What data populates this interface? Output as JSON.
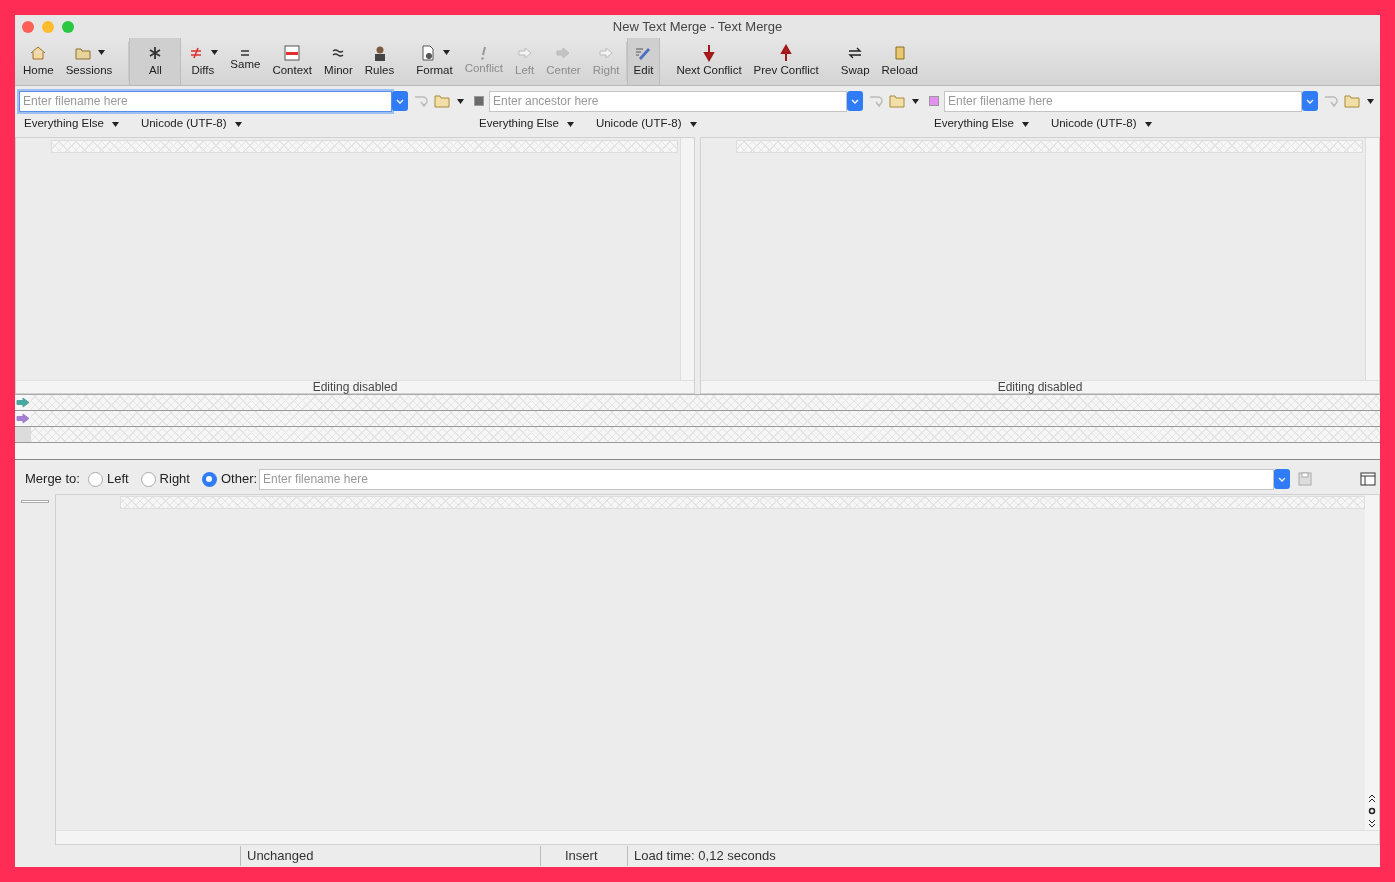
{
  "window": {
    "title": "New Text Merge - Text Merge"
  },
  "toolbar": [
    {
      "label": "Home",
      "selected": false,
      "disabled": false,
      "dropdown": false
    },
    {
      "label": "Sessions",
      "selected": false,
      "disabled": false,
      "dropdown": true
    },
    {
      "label": "All",
      "selected": true,
      "disabled": false,
      "dropdown": false
    },
    {
      "label": "Diffs",
      "selected": false,
      "disabled": false,
      "dropdown": true
    },
    {
      "label": "Same",
      "selected": false,
      "disabled": false,
      "dropdown": false
    },
    {
      "label": "Context",
      "selected": false,
      "disabled": false,
      "dropdown": false
    },
    {
      "label": "Minor",
      "selected": false,
      "disabled": false,
      "dropdown": false
    },
    {
      "label": "Rules",
      "selected": false,
      "disabled": false,
      "dropdown": false
    },
    {
      "label": "Format",
      "selected": false,
      "disabled": false,
      "dropdown": true
    },
    {
      "label": "Conflict",
      "selected": false,
      "disabled": true,
      "dropdown": false
    },
    {
      "label": "Left",
      "selected": false,
      "disabled": true,
      "dropdown": false
    },
    {
      "label": "Center",
      "selected": false,
      "disabled": true,
      "dropdown": false
    },
    {
      "label": "Right",
      "selected": false,
      "disabled": true,
      "dropdown": false
    },
    {
      "label": "Edit",
      "selected": true,
      "disabled": false,
      "dropdown": false
    },
    {
      "label": "Next Conflict",
      "selected": false,
      "disabled": false,
      "dropdown": false
    },
    {
      "label": "Prev Conflict",
      "selected": false,
      "disabled": false,
      "dropdown": false
    },
    {
      "label": "Swap",
      "selected": false,
      "disabled": false,
      "dropdown": false
    },
    {
      "label": "Reload",
      "selected": false,
      "disabled": false,
      "dropdown": false
    }
  ],
  "files": [
    {
      "placeholder": "Enter filename here",
      "focused": true,
      "filter": "Everything Else",
      "encoding": "Unicode (UTF-8)"
    },
    {
      "placeholder": "Enter ancestor here",
      "focused": false,
      "color": "#6b6b6b",
      "filter": "Everything Else",
      "encoding": "Unicode (UTF-8)"
    },
    {
      "placeholder": "Enter filename here",
      "focused": false,
      "color": "#e48ef2",
      "filter": "Everything Else",
      "encoding": "Unicode (UTF-8)"
    }
  ],
  "panes": [
    {
      "status": "Editing disabled"
    },
    {
      "status": "Editing disabled"
    }
  ],
  "merge_rows": [
    {
      "kind": "arrow",
      "color": "#4aa89e"
    },
    {
      "kind": "arrow",
      "color": "#a27ed0"
    },
    {
      "kind": "blank"
    }
  ],
  "merge_to": {
    "label": "Merge to:",
    "options": [
      {
        "label": "Left",
        "selected": false
      },
      {
        "label": "Right",
        "selected": false
      },
      {
        "label": "Other:",
        "selected": true
      }
    ],
    "placeholder": "Enter filename here"
  },
  "status_bar": [
    "Unchanged",
    "Insert",
    "Load time: 0,12 seconds"
  ]
}
